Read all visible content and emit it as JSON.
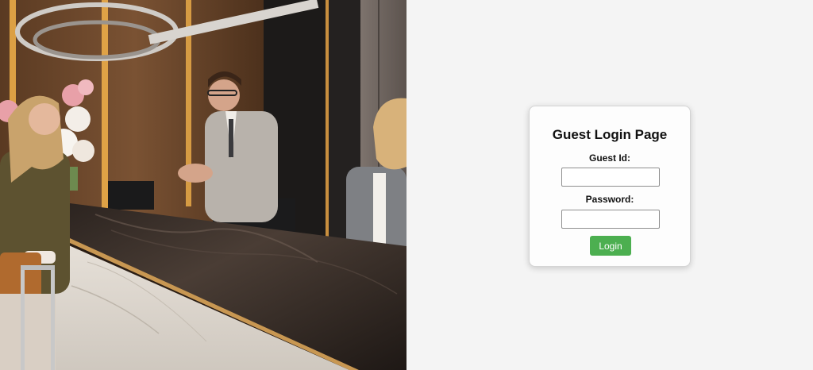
{
  "hero": {
    "image_description_icon": "hotel-reception-photo"
  },
  "login": {
    "title": "Guest Login Page",
    "guest_id_label": "Guest Id:",
    "guest_id_value": "",
    "guest_id_placeholder": "",
    "password_label": "Password:",
    "password_value": "",
    "password_placeholder": "",
    "button_label": "Login",
    "button_color": "#4caf50"
  }
}
